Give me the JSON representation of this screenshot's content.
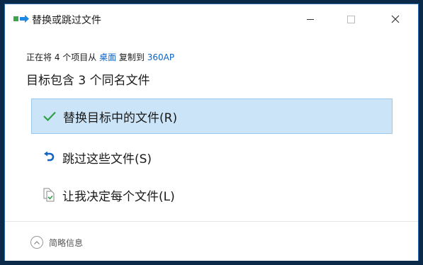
{
  "window": {
    "title": "替换或跳过文件",
    "controls": {
      "minimize_icon": "minimize-icon",
      "maximize_icon": "maximize-icon",
      "close_icon": "close-icon"
    }
  },
  "progress": {
    "prefix": "正在将 4 个项目从 ",
    "source": "桌面",
    "middle": " 复制到 ",
    "destination": "360AP"
  },
  "headline": "目标包含 3 个同名文件",
  "options": [
    {
      "label": "替换目标中的文件(R)",
      "icon": "checkmark-icon",
      "selected": true
    },
    {
      "label": "跳过这些文件(S)",
      "icon": "undo-arrow-icon",
      "selected": false
    },
    {
      "label": "让我决定每个文件(L)",
      "icon": "file-compare-icon",
      "selected": false
    }
  ],
  "footer": {
    "more_info_label": "简略信息",
    "icon": "chevron-up-icon"
  },
  "colors": {
    "accent": "#0b63c4",
    "selected_bg": "#cce4f7",
    "selected_border": "#99c9ef",
    "check_green": "#2e9e4a"
  }
}
